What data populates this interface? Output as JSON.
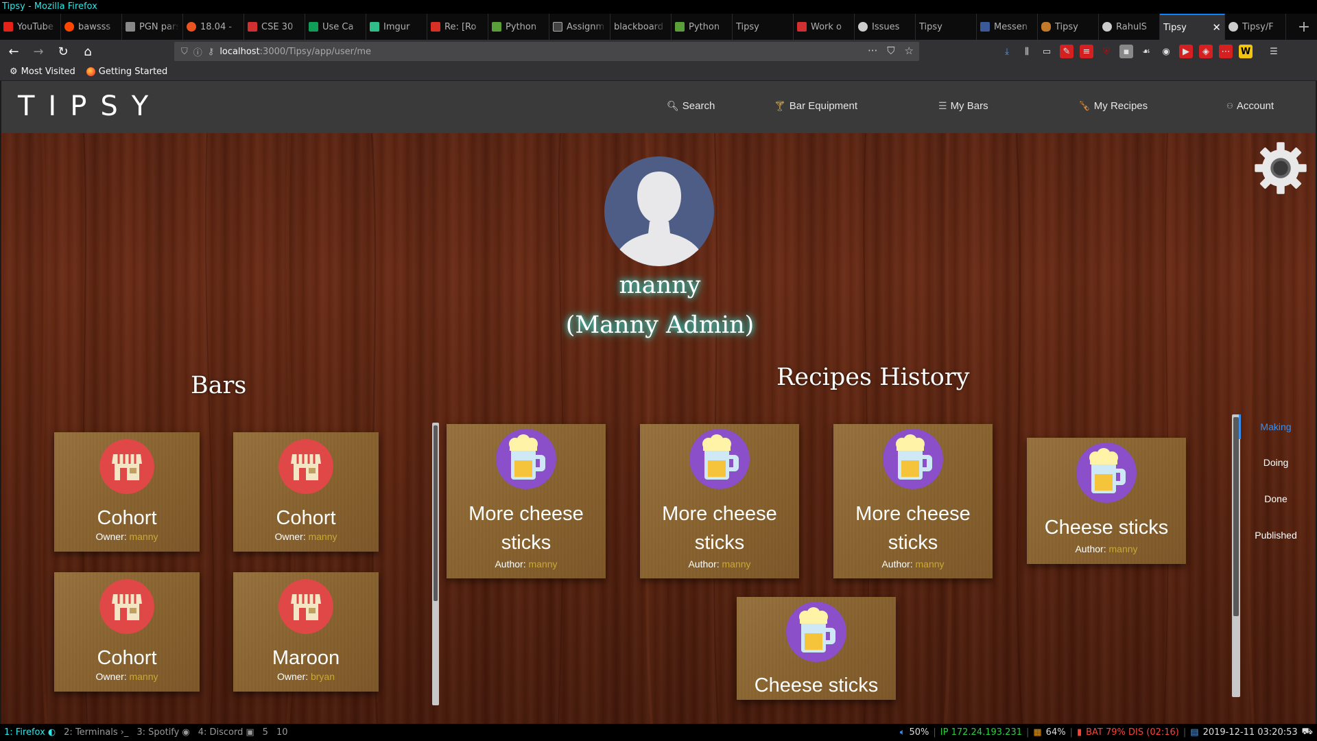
{
  "window": {
    "title": "Tipsy - Mozilla Firefox"
  },
  "tabs": [
    {
      "label": "YouTube",
      "color": "#e62117"
    },
    {
      "label": "bawsss",
      "color": "#ff4500"
    },
    {
      "label": "PGN parser",
      "color": "#888888"
    },
    {
      "label": "18.04 -",
      "color": "#e95420"
    },
    {
      "label": "CSE 30",
      "color": "#d03030"
    },
    {
      "label": "Use Ca",
      "color": "#0f9d58"
    },
    {
      "label": "Imgur",
      "color": "#2fbd8a"
    },
    {
      "label": "Re: [Ro",
      "color": "#d93025"
    },
    {
      "label": "Python",
      "color": "#5a9e3a"
    },
    {
      "label": "Assignm",
      "color": "#444444"
    },
    {
      "label": "blackboard",
      "color": ""
    },
    {
      "label": "Python",
      "color": "#5a9e3a"
    },
    {
      "label": "Tipsy",
      "color": ""
    },
    {
      "label": "Work o",
      "color": "#d03030"
    },
    {
      "label": "Issues",
      "color": "#cccccc"
    },
    {
      "label": "Tipsy",
      "color": ""
    },
    {
      "label": "Messen",
      "color": "#3b5998"
    },
    {
      "label": "Tipsy",
      "color": "#c07a2a"
    },
    {
      "label": "RahulS",
      "color": "#cccccc"
    },
    {
      "label": "Tipsy",
      "color": "",
      "active": true
    },
    {
      "label": "Tipsy/F",
      "color": "#cccccc"
    }
  ],
  "url": {
    "host": "localhost",
    "path": ":3000/Tipsy/app/user/me"
  },
  "bookmarks": {
    "most_visited": "Most Visited",
    "getting_started": "Getting Started"
  },
  "app": {
    "logo": "TIPSY",
    "nav": {
      "search": "Search",
      "bar_equipment": "Bar Equipment",
      "my_bars": "My Bars",
      "my_recipes": "My Recipes",
      "account": "Account"
    },
    "profile": {
      "username": "manny",
      "full_name": "(Manny Admin)"
    },
    "bars_title": "Bars",
    "recipes_title": "Recipes History",
    "bars": [
      {
        "name": "Cohort",
        "owner_label": "Owner:",
        "owner": "manny"
      },
      {
        "name": "Cohort",
        "owner_label": "Owner:",
        "owner": "manny"
      },
      {
        "name": "Cohort",
        "owner_label": "Owner:",
        "owner": "manny"
      },
      {
        "name": "Maroon",
        "owner_label": "Owner:",
        "owner": "bryan"
      }
    ],
    "recipes": [
      {
        "name_line1": "More cheese",
        "name_line2": "sticks",
        "author_label": "Author:",
        "author": "manny"
      },
      {
        "name_line1": "More cheese",
        "name_line2": "sticks",
        "author_label": "Author:",
        "author": "manny"
      },
      {
        "name_line1": "More cheese",
        "name_line2": "sticks",
        "author_label": "Author:",
        "author": "manny"
      },
      {
        "name_line1": "Cheese sticks",
        "name_line2": "",
        "author_label": "Author:",
        "author": "manny"
      },
      {
        "name_line1": "Cheese sticks",
        "name_line2": "",
        "author_label": "",
        "author": ""
      }
    ],
    "status_tabs": [
      "Making",
      "Doing",
      "Done",
      "Published"
    ],
    "active_status": "Making"
  },
  "i3": {
    "workspaces": [
      "1: Firefox",
      "2: Terminals",
      "3: Spotify",
      "4: Discord",
      "5",
      "10"
    ],
    "volume": "50%",
    "ip": "IP 172.24.193.231",
    "disk": "64%",
    "battery": "BAT 79% DIS (02:16)",
    "datetime": "2019-12-11 03:20:53"
  },
  "colors": {
    "accent": "#0a84ff",
    "gold": "#c9a83a",
    "glow": "#3af0e0",
    "active_status": "#3b8eea"
  }
}
